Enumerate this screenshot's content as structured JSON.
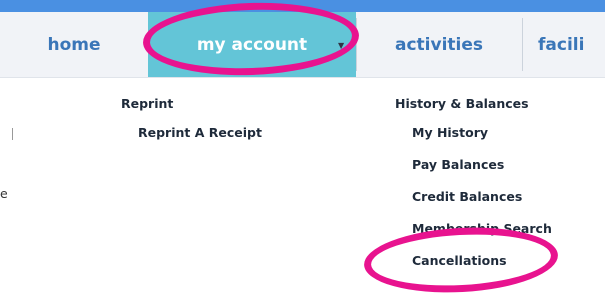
{
  "nav": {
    "home": "home",
    "my_account": "my account",
    "activities": "activities",
    "facilities": "facili"
  },
  "menu_left": {
    "section": "Reprint",
    "item": "Reprint A Receipt"
  },
  "menu_right": {
    "section": "History & Balances",
    "items": [
      "My History",
      "Pay Balances",
      "Credit Balances",
      "Membership Search",
      "Cancellations"
    ]
  },
  "clipped_left_text": "e",
  "colors": {
    "top_bar": "#4a90e2",
    "nav_bg": "#f1f3f7",
    "active_tab": "#63c5d7",
    "nav_text": "#3a76b8",
    "highlight_ring": "#e8138f"
  }
}
